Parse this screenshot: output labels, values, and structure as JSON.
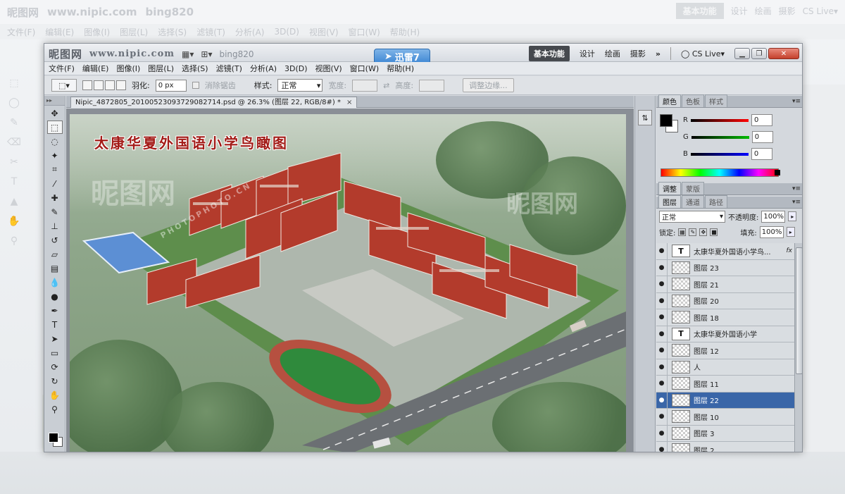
{
  "app": {
    "logo_text": "昵图网",
    "site_text": "www.nipic.com",
    "user": "bing820",
    "xunlei_label": "迅雷7"
  },
  "workspaces": {
    "active": "基本功能",
    "items": [
      "设计",
      "绘画",
      "摄影"
    ],
    "more": "»",
    "cs_live": "CS Live▾"
  },
  "menu": [
    "文件(F)",
    "编辑(E)",
    "图像(I)",
    "图层(L)",
    "选择(S)",
    "滤镜(T)",
    "分析(A)",
    "3D(D)",
    "视图(V)",
    "窗口(W)",
    "帮助(H)"
  ],
  "options": {
    "feather_label": "羽化:",
    "feather_value": "0 px",
    "antialias_label": "消除锯齿",
    "style_label": "样式:",
    "style_value": "正常",
    "width_label": "宽度:",
    "height_label": "高度:",
    "refine_edge": "调整边缘..."
  },
  "document": {
    "tab_title": "Nipic_4872805_20100523093729082714.psd @ 26.3% (图层 22, RGB/8#) *",
    "close": "×",
    "art_title": "太康华夏外国语小学鸟瞰图",
    "watermark": "昵图网",
    "watermark_sub": "PHOTOPHOTO.CN"
  },
  "color_panel": {
    "tabs": [
      "颜色",
      "色板",
      "样式"
    ],
    "r_label": "R",
    "r_value": "0",
    "g_label": "G",
    "g_value": "0",
    "b_label": "B",
    "b_value": "0"
  },
  "adjust_panel": {
    "tabs": [
      "调整",
      "蒙版"
    ]
  },
  "layers_panel": {
    "tabs": [
      "图层",
      "通道",
      "路径"
    ],
    "blend_mode": "正常",
    "opacity_label": "不透明度:",
    "opacity_value": "100%",
    "lock_label": "锁定:",
    "fill_label": "填充:",
    "fill_value": "100%",
    "layers": [
      {
        "name": "太康华夏外国语小学鸟...",
        "type": "text",
        "fx": "fx"
      },
      {
        "name": "图层 23",
        "type": "pixel"
      },
      {
        "name": "图层 21",
        "type": "pixel"
      },
      {
        "name": "图层 20",
        "type": "pixel"
      },
      {
        "name": "图层 18",
        "type": "pixel"
      },
      {
        "name": "太康华夏外国语小学",
        "type": "text"
      },
      {
        "name": "图层 12",
        "type": "pixel"
      },
      {
        "name": "人",
        "type": "pixel"
      },
      {
        "name": "图层 11",
        "type": "pixel"
      },
      {
        "name": "图层 22",
        "type": "pixel",
        "selected": true
      },
      {
        "name": "图层 10",
        "type": "pixel"
      },
      {
        "name": "图层 3",
        "type": "pixel"
      },
      {
        "name": "图层 2",
        "type": "pixel"
      }
    ]
  },
  "colors": {
    "selected_layer": "#3a66a8",
    "title_red": "#a31b17",
    "close_button": "#c4402c"
  }
}
